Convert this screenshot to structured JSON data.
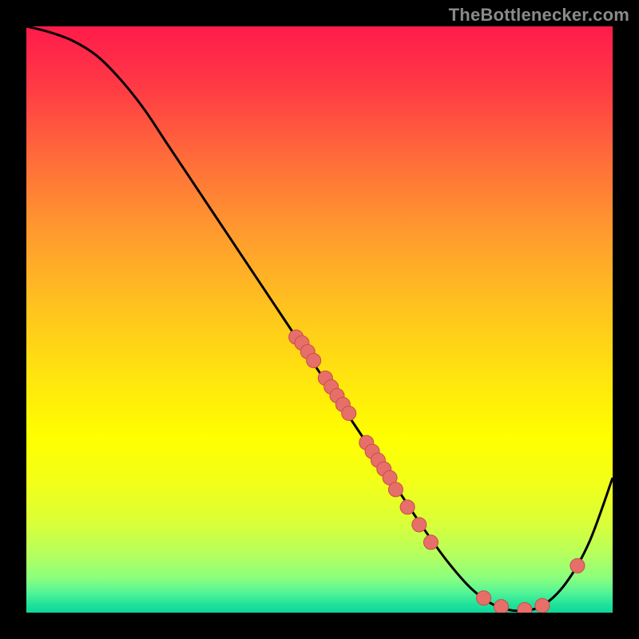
{
  "watermark": "TheBottlenecker.com",
  "colors": {
    "black": "#000000",
    "curve": "#000000",
    "dot": "#e76f6a",
    "dotStroke": "#c84d48"
  },
  "chart_data": {
    "type": "line",
    "title": "",
    "xlabel": "",
    "ylabel": "",
    "xlim": [
      0,
      100
    ],
    "ylim": [
      0,
      100
    ],
    "grid": false,
    "legend": false,
    "series": [
      {
        "name": "curve",
        "x": [
          0,
          4,
          8,
          12,
          16,
          20,
          24,
          28,
          32,
          36,
          40,
          44,
          48,
          52,
          56,
          60,
          64,
          68,
          72,
          76,
          80,
          84,
          88,
          92,
          96,
          100
        ],
        "y": [
          100,
          99,
          97.5,
          95,
          91,
          86,
          80,
          74,
          68,
          62,
          56,
          50,
          44,
          38,
          32,
          26,
          20,
          14,
          8.5,
          4,
          1.2,
          0.3,
          1.2,
          5,
          12,
          23
        ]
      }
    ],
    "points": [
      {
        "name": "cluster-upper",
        "x": 46,
        "y": 47
      },
      {
        "name": "cluster-upper",
        "x": 47,
        "y": 46
      },
      {
        "name": "cluster-upper",
        "x": 48,
        "y": 44.5
      },
      {
        "name": "cluster-upper",
        "x": 49,
        "y": 43
      },
      {
        "name": "cluster-mid",
        "x": 51,
        "y": 40
      },
      {
        "name": "cluster-mid",
        "x": 52,
        "y": 38.5
      },
      {
        "name": "cluster-mid",
        "x": 53,
        "y": 37
      },
      {
        "name": "cluster-mid",
        "x": 54,
        "y": 35.5
      },
      {
        "name": "cluster-mid",
        "x": 55,
        "y": 34
      },
      {
        "name": "cluster-lower",
        "x": 58,
        "y": 29
      },
      {
        "name": "cluster-lower",
        "x": 59,
        "y": 27.5
      },
      {
        "name": "cluster-lower",
        "x": 60,
        "y": 26
      },
      {
        "name": "cluster-lower",
        "x": 61,
        "y": 24.5
      },
      {
        "name": "cluster-lower",
        "x": 62,
        "y": 23
      },
      {
        "name": "cluster-lower",
        "x": 63,
        "y": 21
      },
      {
        "name": "cluster-tail",
        "x": 65,
        "y": 18
      },
      {
        "name": "cluster-tail",
        "x": 67,
        "y": 15
      },
      {
        "name": "cluster-tail",
        "x": 69,
        "y": 12
      },
      {
        "name": "trough-a",
        "x": 78,
        "y": 2.5
      },
      {
        "name": "trough-b",
        "x": 81,
        "y": 1
      },
      {
        "name": "trough-c",
        "x": 85,
        "y": 0.5
      },
      {
        "name": "trough-d",
        "x": 88,
        "y": 1.2
      },
      {
        "name": "rise-a",
        "x": 94,
        "y": 8
      }
    ],
    "gradient_stops": [
      {
        "offset": 0.0,
        "color": "#ff1b4b"
      },
      {
        "offset": 0.1,
        "color": "#ff3945"
      },
      {
        "offset": 0.22,
        "color": "#ff6a3a"
      },
      {
        "offset": 0.35,
        "color": "#ff9a2e"
      },
      {
        "offset": 0.48,
        "color": "#ffc31f"
      },
      {
        "offset": 0.6,
        "color": "#ffe50e"
      },
      {
        "offset": 0.7,
        "color": "#ffff00"
      },
      {
        "offset": 0.78,
        "color": "#f2ff19"
      },
      {
        "offset": 0.85,
        "color": "#d8ff3a"
      },
      {
        "offset": 0.9,
        "color": "#b6ff5d"
      },
      {
        "offset": 0.94,
        "color": "#8cff7d"
      },
      {
        "offset": 0.965,
        "color": "#55f595"
      },
      {
        "offset": 0.985,
        "color": "#22e39b"
      },
      {
        "offset": 1.0,
        "color": "#0fd69a"
      }
    ]
  }
}
